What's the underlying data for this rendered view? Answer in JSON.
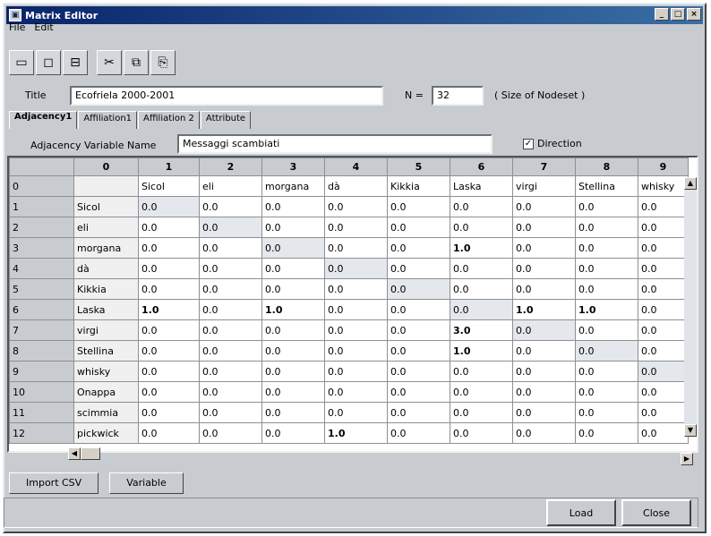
{
  "window": {
    "title": "Matrix Editor",
    "icon": "app-icon",
    "controls": [
      "_",
      "□",
      "×"
    ]
  },
  "menu": [
    "File",
    "Edit"
  ],
  "toolbar": {
    "icons": [
      "new-icon",
      "open-icon",
      "save-icon",
      "cut-icon",
      "copy-icon",
      "paste-icon"
    ],
    "glyphs": [
      "▭",
      "◻",
      "⧉",
      "✂",
      "⧉",
      "📋"
    ]
  },
  "title_row": {
    "title_label": "Title",
    "title_value": "Ecofriela 2000-2001",
    "n_label": "N =",
    "n_value": "32",
    "n_note": "( Size of Nodeset )"
  },
  "tabs": [
    "Adjacency1",
    "Affiliation1",
    "Affiliation 2",
    "Attribute"
  ],
  "adjacency": {
    "label": "Adjacency Variable Name",
    "value": "Messaggi scambiati",
    "direction_label": "Direction",
    "direction_checked": "✓"
  },
  "grid": {
    "headers": [
      "0",
      "1",
      "2",
      "3",
      "4",
      "5",
      "6",
      "7",
      "8",
      "9"
    ],
    "top_row": [
      "0",
      "",
      "Sicol",
      "eli",
      "morgana",
      "dà",
      "Kikkia",
      "Laska",
      "virgi",
      "Stellina",
      "whisky"
    ],
    "rows": [
      {
        "index": "1",
        "name": "Sicol",
        "values": [
          "0.0",
          "0.0",
          "0.0",
          "0.0",
          "0.0",
          "0.0",
          "0.0",
          "0.0",
          "0.0"
        ]
      },
      {
        "index": "2",
        "name": "eli",
        "values": [
          "0.0",
          "0.0",
          "0.0",
          "0.0",
          "0.0",
          "0.0",
          "0.0",
          "0.0",
          "0.0"
        ]
      },
      {
        "index": "3",
        "name": "morgana",
        "values": [
          "0.0",
          "0.0",
          "0.0",
          "0.0",
          "0.0",
          "1.0",
          "0.0",
          "0.0",
          "0.0"
        ]
      },
      {
        "index": "4",
        "name": "dà",
        "values": [
          "0.0",
          "0.0",
          "0.0",
          "0.0",
          "0.0",
          "0.0",
          "0.0",
          "0.0",
          "0.0"
        ]
      },
      {
        "index": "5",
        "name": "Kikkia",
        "values": [
          "0.0",
          "0.0",
          "0.0",
          "0.0",
          "0.0",
          "0.0",
          "0.0",
          "0.0",
          "0.0"
        ]
      },
      {
        "index": "6",
        "name": "Laska",
        "values": [
          "1.0",
          "0.0",
          "1.0",
          "0.0",
          "0.0",
          "0.0",
          "1.0",
          "1.0",
          "0.0"
        ]
      },
      {
        "index": "7",
        "name": "virgi",
        "values": [
          "0.0",
          "0.0",
          "0.0",
          "0.0",
          "0.0",
          "3.0",
          "0.0",
          "0.0",
          "0.0"
        ]
      },
      {
        "index": "8",
        "name": "Stellina",
        "values": [
          "0.0",
          "0.0",
          "0.0",
          "0.0",
          "0.0",
          "1.0",
          "0.0",
          "0.0",
          "0.0"
        ]
      },
      {
        "index": "9",
        "name": "whisky",
        "values": [
          "0.0",
          "0.0",
          "0.0",
          "0.0",
          "0.0",
          "0.0",
          "0.0",
          "0.0",
          "0.0"
        ]
      },
      {
        "index": "10",
        "name": "Onappa",
        "values": [
          "0.0",
          "0.0",
          "0.0",
          "0.0",
          "0.0",
          "0.0",
          "0.0",
          "0.0",
          "0.0"
        ]
      },
      {
        "index": "11",
        "name": "scimmia",
        "values": [
          "0.0",
          "0.0",
          "0.0",
          "0.0",
          "0.0",
          "0.0",
          "0.0",
          "0.0",
          "0.0"
        ]
      },
      {
        "index": "12",
        "name": "pickwick",
        "values": [
          "0.0",
          "0.0",
          "0.0",
          "1.0",
          "0.0",
          "0.0",
          "0.0",
          "0.0",
          "0.0"
        ]
      }
    ]
  },
  "bottom_tabs": [
    "Import CSV",
    "Variable"
  ],
  "actions": {
    "load": "Load",
    "close": "Close"
  }
}
